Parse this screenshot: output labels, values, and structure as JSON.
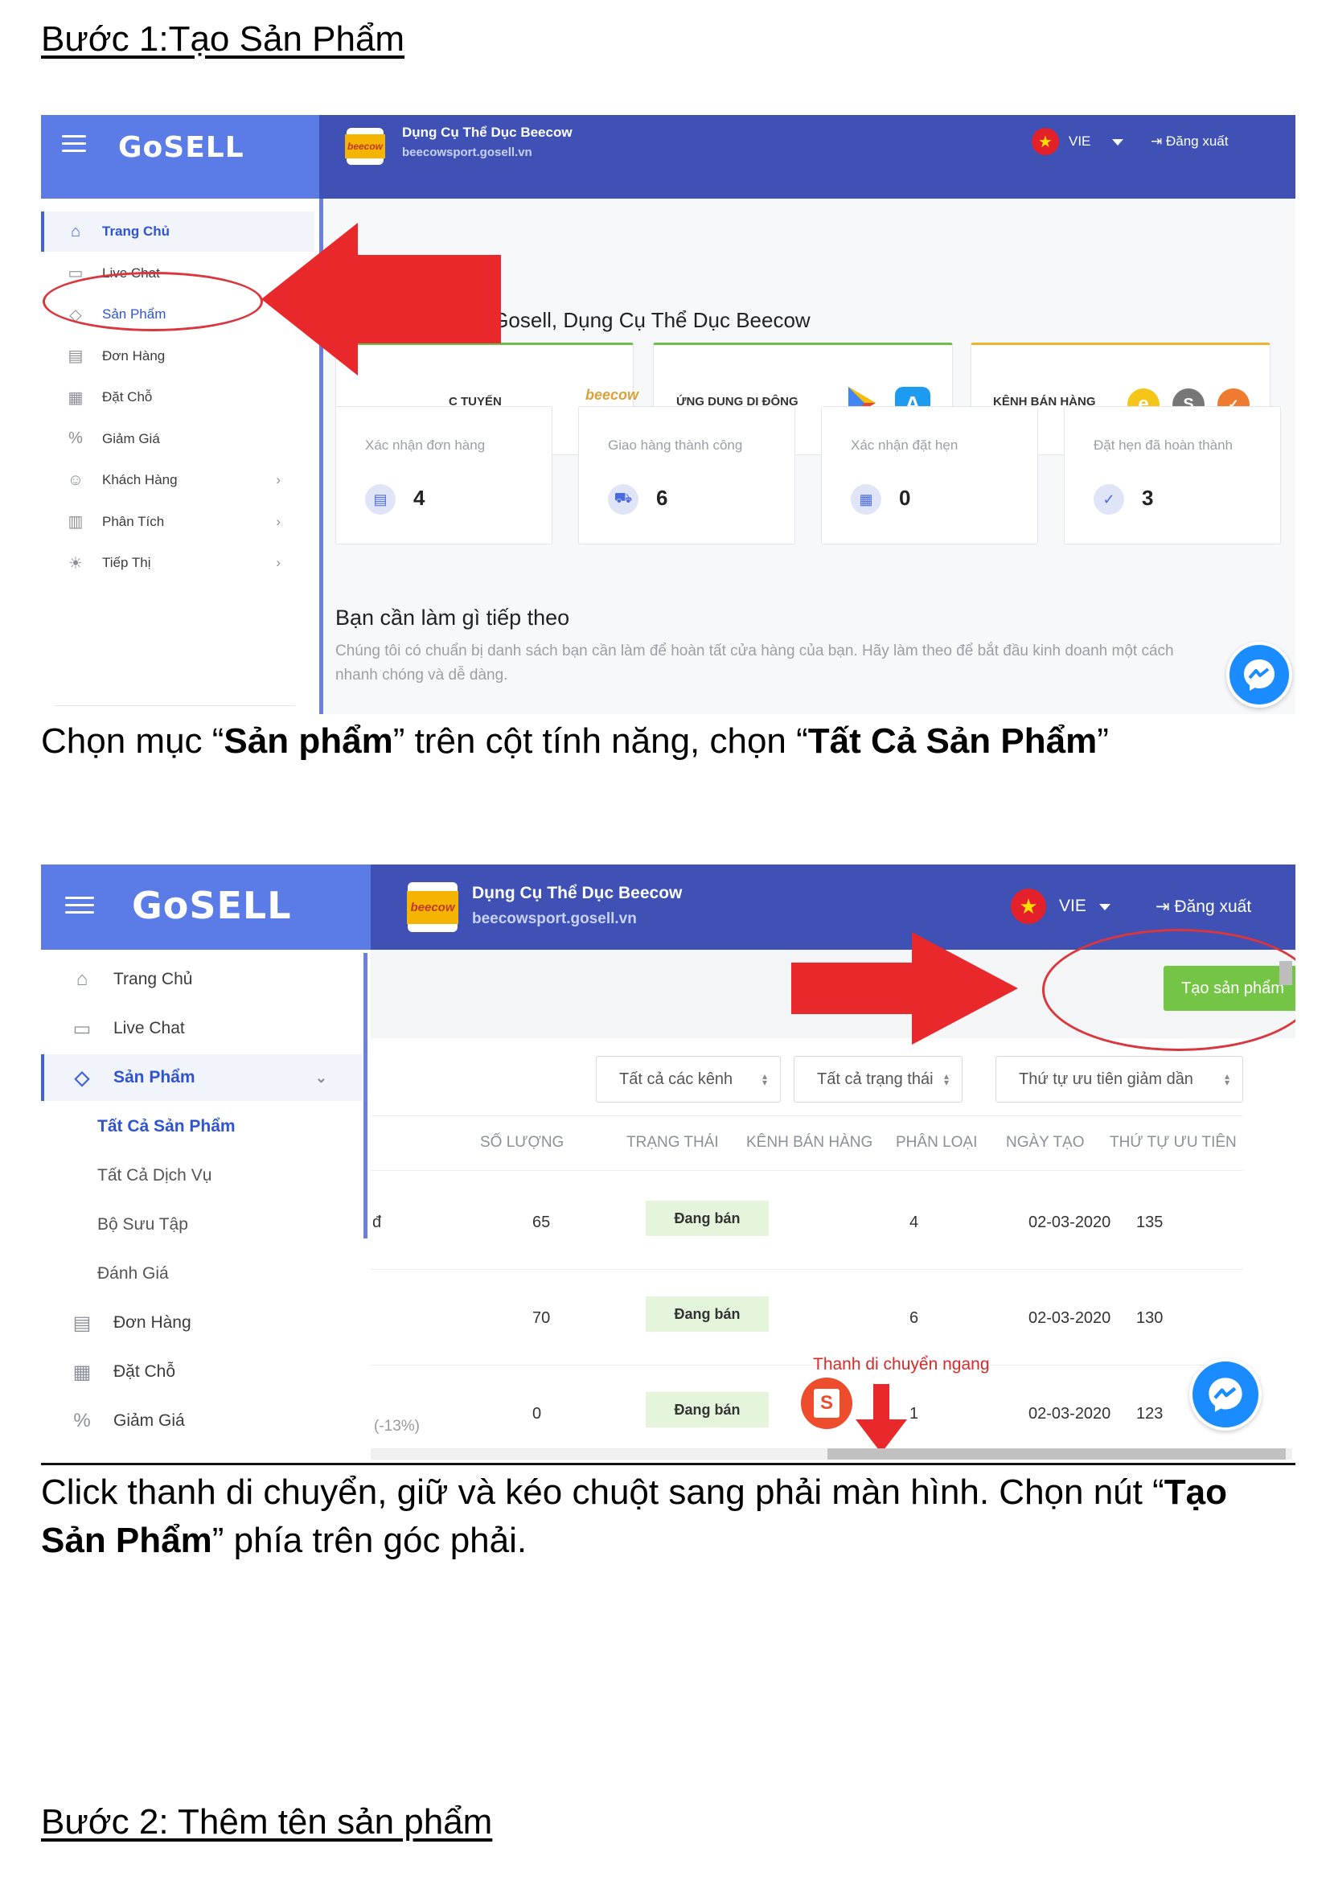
{
  "doc": {
    "step1_title": "Bước 1:Tạo Sản Phẩm ",
    "step1_desc_1": "Chọn mục “",
    "step1_desc_bold1": "Sản phẩm",
    "step1_desc_2": "” trên cột tính năng, chọn “",
    "step1_desc_bold2": "Tất Cả Sản Phẩm",
    "step1_desc_3": "”",
    "step2_desc_1": "Click thanh di chuyển, giữ và kéo chuột sang phải màn hình. Chọn nút “",
    "step2_desc_bold": "Tạo Sản Phẩm",
    "step2_desc_2": "” phía trên góc phải.",
    "step2_title": "Bước 2: Thêm tên sản phẩm"
  },
  "header": {
    "brand": "GoSELL",
    "store_logo_text": "beecow",
    "store_name": "Dụng Cụ Thể Dục Beecow",
    "store_url": "beecowsport.gosell.vn",
    "language": "VIE",
    "logout": "Đăng xuất"
  },
  "shot1": {
    "sidebar": [
      {
        "label": "Trang Chủ",
        "icon": "home-icon"
      },
      {
        "label": "Live Chat",
        "icon": "chat-icon"
      },
      {
        "label": "Sản Phẩm",
        "icon": "tag-icon"
      },
      {
        "label": "Đơn Hàng",
        "icon": "receipt-icon"
      },
      {
        "label": "Đặt Chỗ",
        "icon": "calendar-icon"
      },
      {
        "label": "Giảm Giá",
        "icon": "discount-icon"
      },
      {
        "label": "Khách Hàng",
        "icon": "users-icon"
      },
      {
        "label": "Phân Tích",
        "icon": "chart-icon"
      },
      {
        "label": "Tiếp Thị",
        "icon": "bulb-icon"
      }
    ],
    "channels_heading": "KÊNH BÁN HÀNG",
    "channels": [
      "Cửa Hàng Trực Tuyến",
      "Shopee"
    ],
    "welcome": "Chào mừng đến Gosell, Dụng Cụ Thể Dục Beecow",
    "tiles": [
      "C TUYẾN",
      "ỨNG DỤNG DI ĐỘNG",
      "KÊNH BÁN HÀNG"
    ],
    "stats": [
      {
        "label": "Xác nhận đơn hàng",
        "value": "4"
      },
      {
        "label": "Giao hàng thành công",
        "value": "6"
      },
      {
        "label": "Xác nhận đặt hẹn",
        "value": "0"
      },
      {
        "label": "Đặt hẹn đã hoàn thành",
        "value": "3"
      }
    ],
    "next_title": "Bạn cần làm gì tiếp theo",
    "next_desc_1": "Chúng tôi có chuẩn bị danh sách bạn cần làm để hoàn tất cửa hàng của bạn. Hãy làm theo để bắt đầu kinh doanh một cách",
    "next_desc_2": "nhanh chóng và dễ dàng."
  },
  "shot2": {
    "sidebar": [
      {
        "label": "Trang Chủ"
      },
      {
        "label": "Live Chat"
      },
      {
        "label": "Sản Phẩm"
      },
      {
        "label": "Tất Cả Sản Phẩm"
      },
      {
        "label": "Tất Cả Dịch Vụ"
      },
      {
        "label": "Bộ Sưu Tập"
      },
      {
        "label": "Đánh Giá"
      },
      {
        "label": "Đơn Hàng"
      },
      {
        "label": "Đặt Chỗ"
      },
      {
        "label": "Giảm Giá"
      }
    ],
    "create_button": "Tạo sản phẩm",
    "filters": [
      "Tất cả các kênh",
      "Tất cả trạng thái",
      "Thứ tự ưu tiên giảm dần"
    ],
    "columns": [
      "SỐ LƯỢNG",
      "TRẠNG THÁI",
      "KÊNH BÁN HÀNG",
      "PHÂN LOẠI",
      "NGÀY TẠO",
      "THỨ TỰ ƯU TIÊN"
    ],
    "rows": [
      {
        "prefix": "đ",
        "qty": "65",
        "status": "Đang bán",
        "variants": "4",
        "date": "02-03-2020",
        "priority": "135"
      },
      {
        "prefix": "",
        "qty": "70",
        "status": "Đang bán",
        "variants": "6",
        "date": "02-03-2020",
        "priority": "130"
      },
      {
        "prefix": "(-13%)",
        "qty": "0",
        "status": "Đang bán",
        "variants": "1",
        "date": "02-03-2020",
        "priority": "123"
      }
    ],
    "scroll_annotation": "Thanh di chuyển ngang"
  }
}
